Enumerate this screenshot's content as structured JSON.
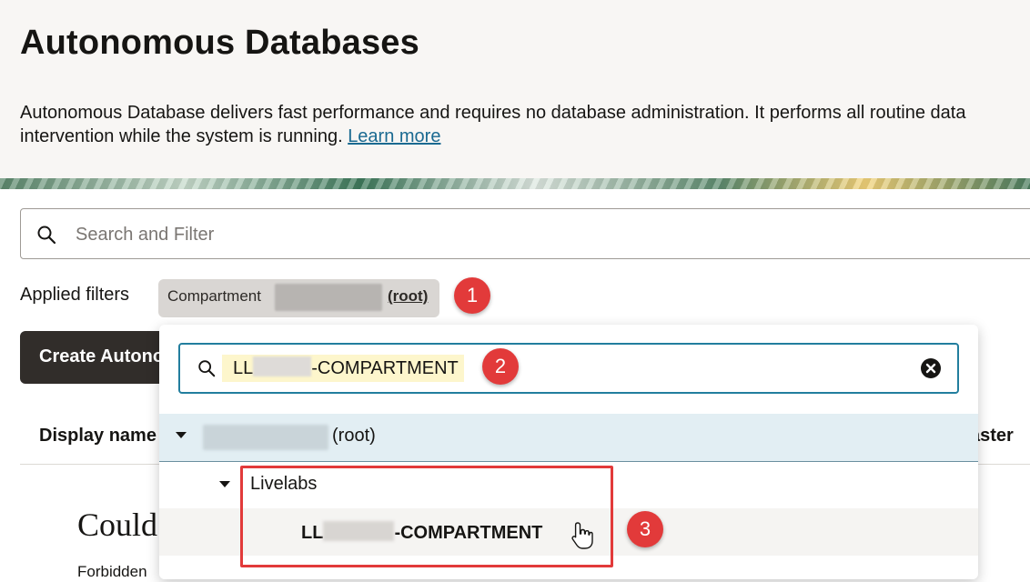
{
  "header": {
    "title": "Autonomous Databases",
    "description_line1": "Autonomous Database delivers fast performance and requires no database administration. It performs all routine data",
    "description_line2": "intervention while the system is running.",
    "learn_more": "Learn more"
  },
  "search": {
    "placeholder": "Search and Filter"
  },
  "filters": {
    "label": "Applied filters",
    "chip_prefix": "Compartment",
    "chip_value": "(root)"
  },
  "toolbar": {
    "create_label": "Create Autono"
  },
  "table": {
    "columns": [
      "Display name",
      "aster"
    ]
  },
  "error": {
    "title": "Could",
    "body": "Forbidden"
  },
  "dropdown": {
    "search_prefix": "LL",
    "search_suffix": "-COMPARTMENT",
    "root_label": "(root)",
    "child_label": "Livelabs",
    "grandchild_prefix": "LL",
    "grandchild_suffix": "-COMPARTMENT"
  },
  "annotations": {
    "step1": "1",
    "step2": "2",
    "step3": "3",
    "color": "#e23a3a"
  },
  "icons": [
    "search-icon",
    "clear-icon",
    "caret-down-icon",
    "hand-cursor-icon"
  ]
}
